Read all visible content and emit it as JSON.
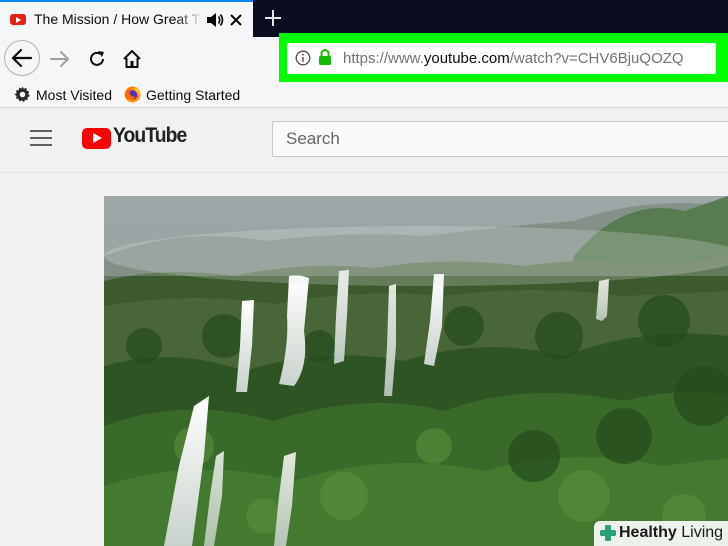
{
  "browser": {
    "tab": {
      "title": "The Mission / How Great Thou Art",
      "favicon": "youtube-favicon-icon",
      "audio_icon": "speaker-icon",
      "close_icon": "close-icon"
    },
    "new_tab_icon": "plus-icon",
    "nav": {
      "back_icon": "back-arrow-icon",
      "forward_icon": "forward-arrow-icon",
      "reload_icon": "reload-icon",
      "home_icon": "home-icon"
    },
    "urlbar": {
      "info_icon": "info-icon",
      "lock_icon": "lock-icon",
      "url_prefix": "https://www.",
      "url_domain": "youtube.com",
      "url_suffix": "/watch?v=CHV6BjuQOZQ",
      "highlight_color": "#00ff00"
    },
    "bookmarks": [
      {
        "label": "Most Visited",
        "icon": "gear-icon"
      },
      {
        "label": "Getting Started",
        "icon": "firefox-icon"
      }
    ]
  },
  "youtube": {
    "menu_icon": "hamburger-menu-icon",
    "logo_text": "YouTube",
    "brand_color": "#ff0000",
    "search": {
      "placeholder": "Search"
    }
  },
  "video": {
    "thumbnail": "waterfall-landscape-image"
  },
  "watermark": {
    "text_bold": "Healthy",
    "text_regular": " Living"
  }
}
